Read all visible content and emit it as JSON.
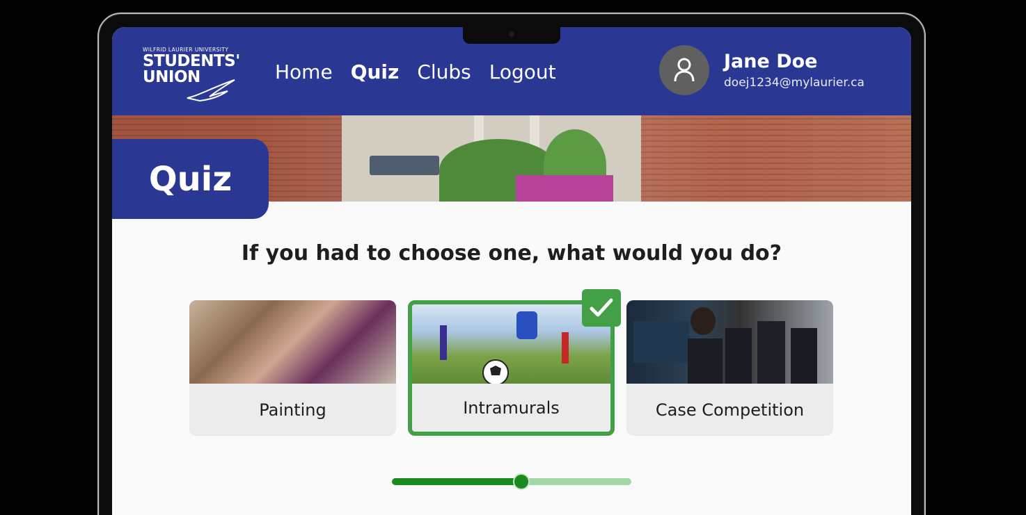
{
  "header": {
    "logo": {
      "line1": "WILFRID LAURIER UNIVERSITY",
      "line2": "STUDENTS'",
      "line3": "UNION"
    },
    "nav": [
      {
        "label": "Home",
        "active": false
      },
      {
        "label": "Quiz",
        "active": true
      },
      {
        "label": "Clubs",
        "active": false
      },
      {
        "label": "Logout",
        "active": false
      }
    ],
    "user": {
      "name": "Jane Doe",
      "email": "doej1234@mylaurier.ca",
      "avatar_icon": "user-icon"
    }
  },
  "page": {
    "title": "Quiz"
  },
  "quiz": {
    "question": "If you had to choose one, what would you do?",
    "options": [
      {
        "label": "Painting",
        "selected": false
      },
      {
        "label": "Intramurals",
        "selected": true
      },
      {
        "label": "Case Competition",
        "selected": false
      }
    ],
    "selected_icon": "checkmark-icon",
    "progress": 0.54
  },
  "colors": {
    "brand": "#2a3894",
    "selected": "#43a047",
    "progress_fill": "#1b8a1f",
    "progress_track": "#a5d6a7"
  }
}
